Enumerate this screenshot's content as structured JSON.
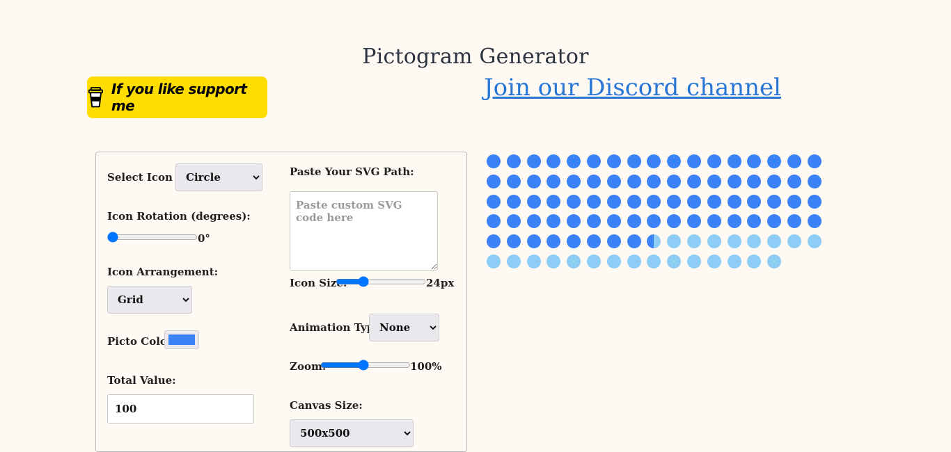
{
  "header": {
    "title": "Pictogram Generator",
    "support_label": "If you like support me",
    "discord_label": "Join our Discord channel"
  },
  "controls": {
    "select_icon_label": "Select Icon or:",
    "icon_selected": "Circle",
    "svg_path_label": "Paste Your SVG Path:",
    "svg_placeholder": "Paste custom SVG code here",
    "rotation_label": "Icon Rotation (degrees):",
    "rotation_value": 0,
    "rotation_max": 360,
    "rotation_display": "0°",
    "icon_size_label": "Icon Size:",
    "icon_size_value": 24,
    "icon_size_min": 10,
    "icon_size_max": 60,
    "icon_size_display": "24px",
    "arrangement_label": "Icon Arrangement:",
    "arrangement_selected": "Grid",
    "animation_label": "Animation Type:",
    "animation_selected": "None",
    "color_label": "Picto Color:",
    "color_value": "#3b82f6",
    "zoom_label": "Zoom:",
    "zoom_value": 100,
    "zoom_min": 10,
    "zoom_max": 200,
    "zoom_display": "100%",
    "total_label": "Total Value:",
    "total_value": "100",
    "canvas_label": "Canvas Size:",
    "canvas_selected": "500x500"
  },
  "pictogram": {
    "shape": "circle",
    "columns": 17,
    "total_icons": 100,
    "filled_value": 76.5,
    "filled_color": "#3b82f6",
    "empty_color": "#8ecdf5"
  }
}
